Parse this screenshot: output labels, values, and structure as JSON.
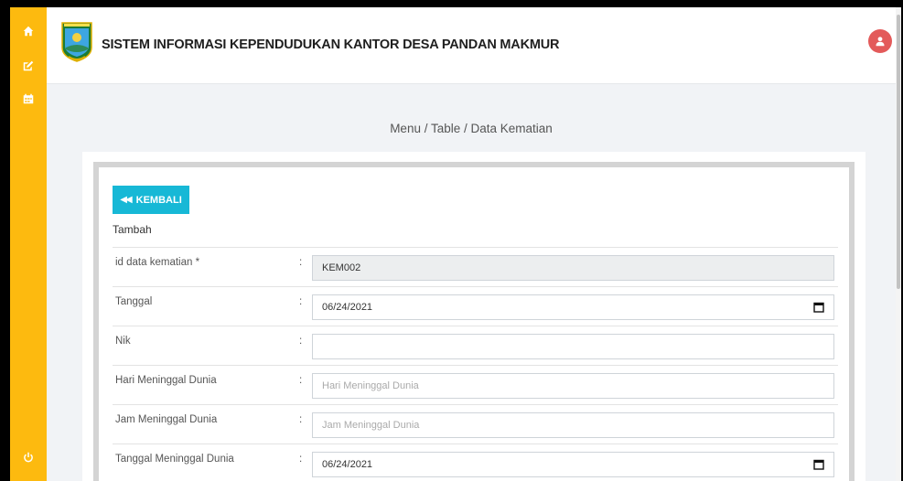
{
  "app": {
    "title": "SISTEM INFORMASI KEPENDUDUKAN KANTOR DESA PANDAN MAKMUR"
  },
  "sidebar": {
    "items": [
      {
        "icon": "home-icon"
      },
      {
        "icon": "edit-icon"
      },
      {
        "icon": "calendar-icon"
      }
    ],
    "bottom_icon": "power-icon"
  },
  "breadcrumb": "Menu / Table / Data Kematian",
  "form": {
    "back_label": "KEMBALI",
    "title": "Tambah",
    "fields": [
      {
        "label": "id data kematian  *",
        "value": "KEM002",
        "placeholder": ""
      },
      {
        "label": "Tanggal",
        "value": "06/24/2021",
        "placeholder": ""
      },
      {
        "label": "Nik",
        "value": "",
        "placeholder": ""
      },
      {
        "label": "Hari Meninggal Dunia",
        "value": "",
        "placeholder": "Hari Meninggal Dunia"
      },
      {
        "label": "Jam Meninggal Dunia",
        "value": "",
        "placeholder": "Jam Meninggal Dunia"
      },
      {
        "label": "Tanggal Meninggal Dunia",
        "value": "06/24/2021",
        "placeholder": ""
      }
    ],
    "colon": ":"
  },
  "colors": {
    "sidebar": "#fdba0f",
    "accent_button": "#17b8d6",
    "avatar": "#e35a5a"
  }
}
